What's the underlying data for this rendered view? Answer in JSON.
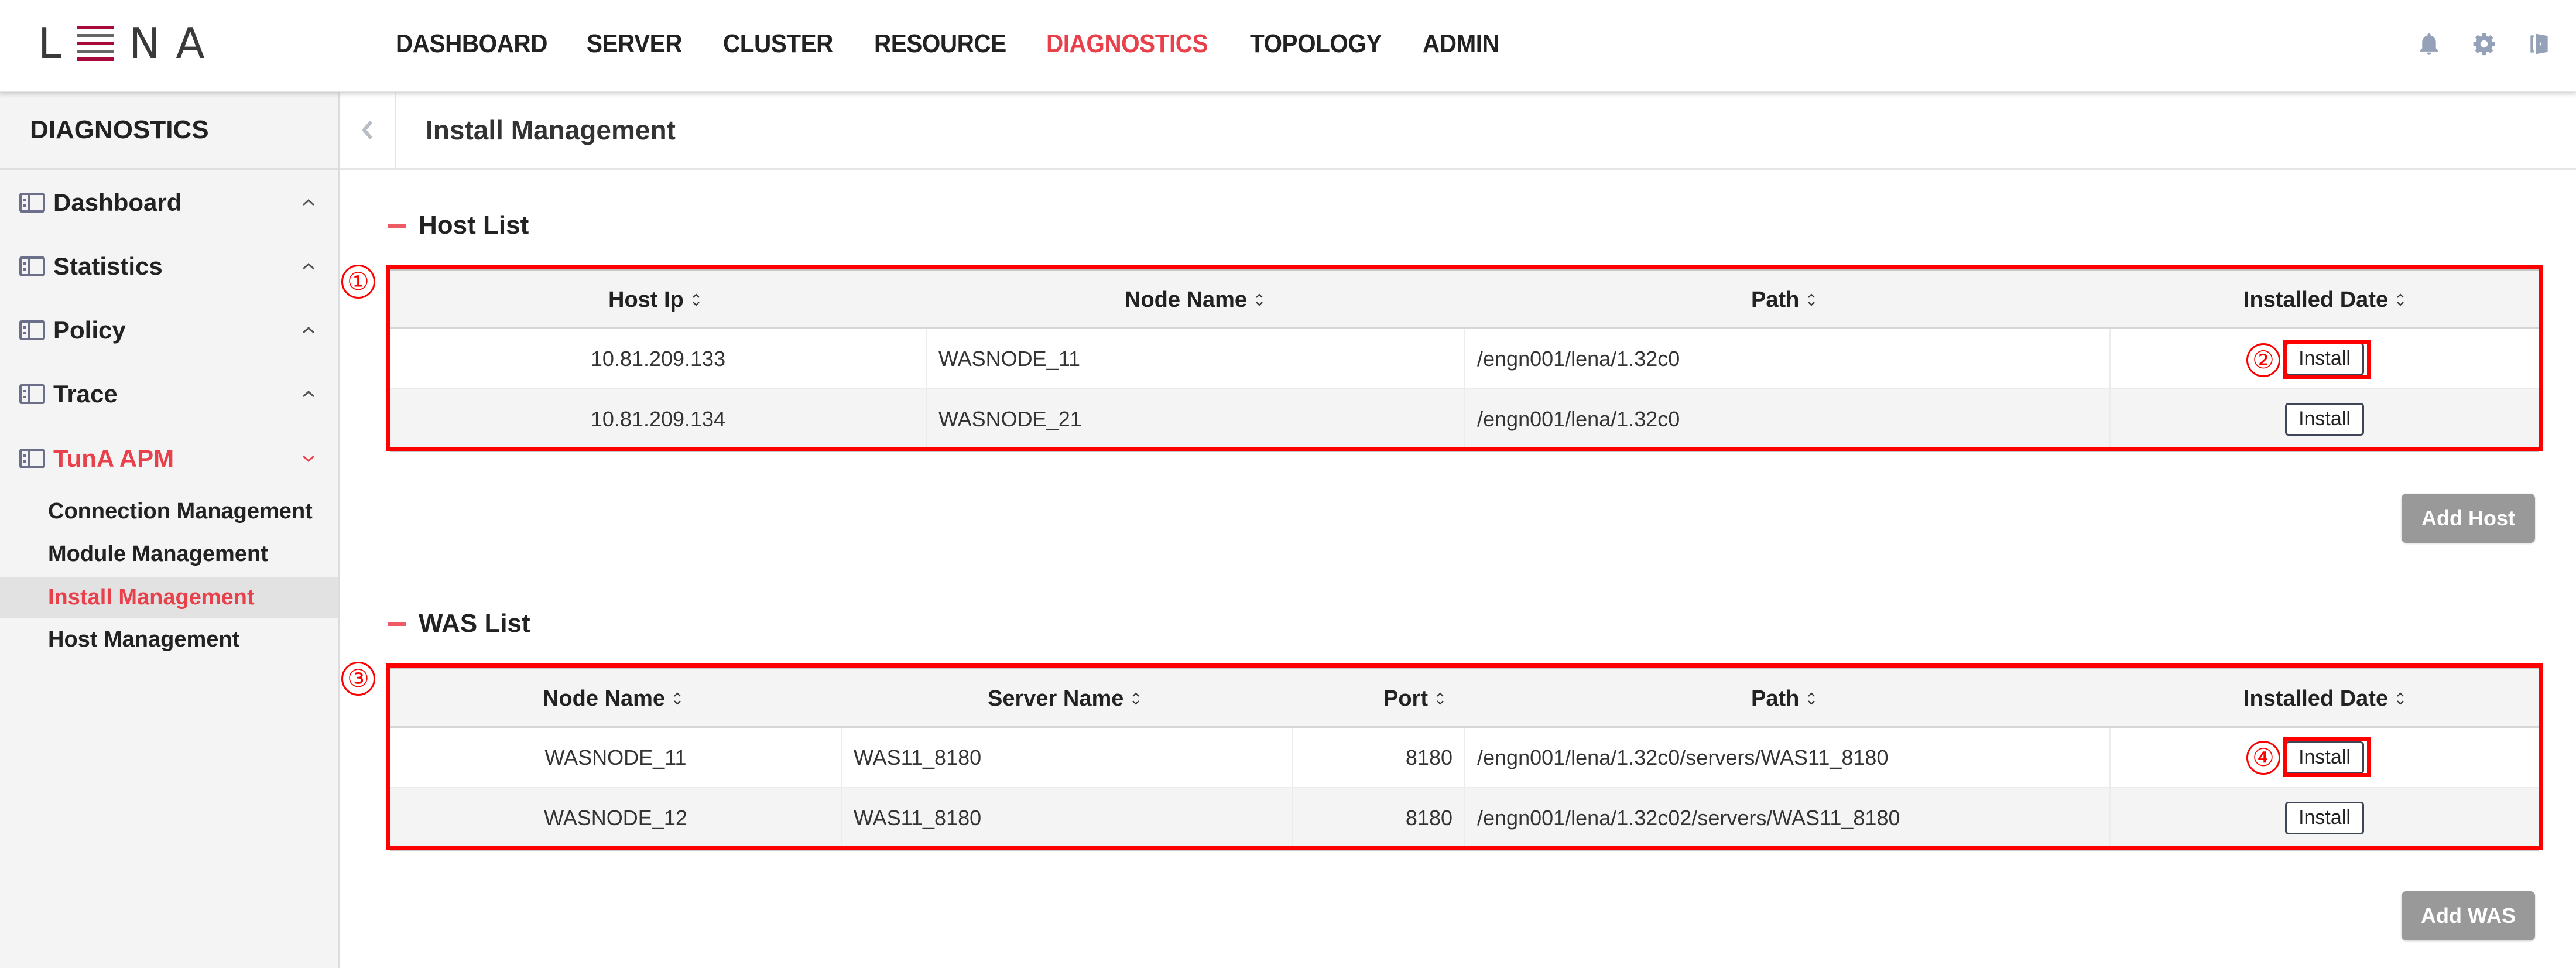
{
  "app": {
    "logo": {
      "letters": [
        "L",
        "N",
        "A"
      ],
      "brand_red": "#a6093a"
    },
    "accent_color": "#e8414b"
  },
  "nav": {
    "items": [
      {
        "label": "DASHBOARD",
        "active": false
      },
      {
        "label": "SERVER",
        "active": false
      },
      {
        "label": "CLUSTER",
        "active": false
      },
      {
        "label": "RESOURCE",
        "active": false
      },
      {
        "label": "DIAGNOSTICS",
        "active": true
      },
      {
        "label": "TOPOLOGY",
        "active": false
      },
      {
        "label": "ADMIN",
        "active": false
      }
    ],
    "right_icons": [
      "bell-icon",
      "gear-icon",
      "logout-door-icon"
    ]
  },
  "sidebar": {
    "title": "DIAGNOSTICS",
    "items": [
      {
        "label": "Dashboard",
        "icon": "panel-layout-icon",
        "expanded": false
      },
      {
        "label": "Statistics",
        "icon": "panel-layout-icon",
        "expanded": false
      },
      {
        "label": "Policy",
        "icon": "panel-layout-icon",
        "expanded": false
      },
      {
        "label": "Trace",
        "icon": "panel-layout-icon",
        "expanded": false
      },
      {
        "label": "TunA APM",
        "icon": "panel-layout-icon",
        "expanded": true
      }
    ],
    "sub_items": [
      {
        "label": "Connection Management",
        "active": false
      },
      {
        "label": "Module Management",
        "active": false
      },
      {
        "label": "Install Management",
        "active": true
      },
      {
        "label": "Host Management",
        "active": false
      }
    ]
  },
  "page": {
    "title": "Install Management"
  },
  "host_list": {
    "title": "Host List",
    "annotation": "①",
    "columns": [
      "Host Ip",
      "Node Name",
      "Path",
      "Installed Date"
    ],
    "rows": [
      {
        "host_ip": "10.81.209.133",
        "node_name": "WASNODE_11",
        "path": "/engn001/lena/1.32c0",
        "action": "Install",
        "annotation": "②"
      },
      {
        "host_ip": "10.81.209.134",
        "node_name": "WASNODE_21",
        "path": "/engn001/lena/1.32c0",
        "action": "Install"
      }
    ],
    "add_button": "Add Host"
  },
  "was_list": {
    "title": "WAS List",
    "annotation": "③",
    "columns": [
      "Node Name",
      "Server Name",
      "Port",
      "Path",
      "Installed Date"
    ],
    "rows": [
      {
        "node_name": "WASNODE_11",
        "server_name": "WAS11_8180",
        "port": "8180",
        "path": "/engn001/lena/1.32c0/servers/WAS11_8180",
        "action": "Install",
        "annotation": "④"
      },
      {
        "node_name": "WASNODE_12",
        "server_name": "WAS11_8180",
        "port": "8180",
        "path": "/engn001/lena/1.32c02/servers/WAS11_8180",
        "action": "Install"
      }
    ],
    "add_button": "Add WAS"
  }
}
